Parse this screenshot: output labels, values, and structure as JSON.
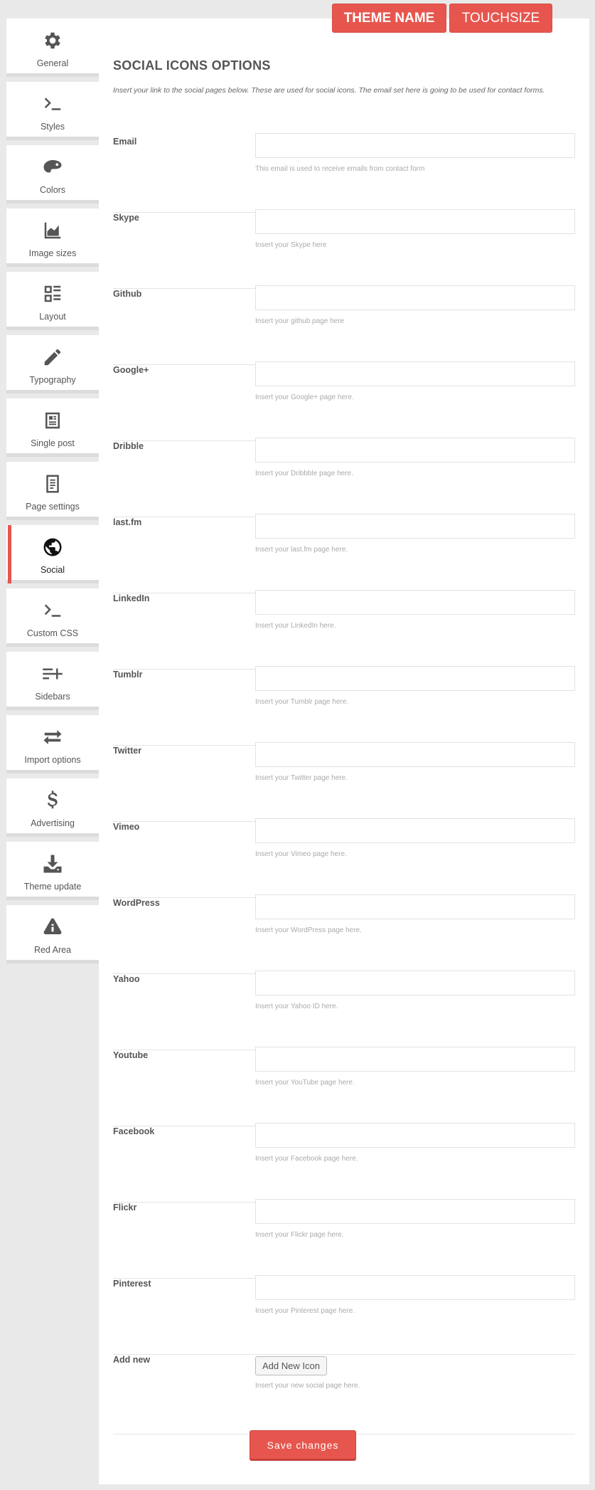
{
  "header": {
    "theme_label": "THEME NAME",
    "touchsize_label": "TOUCHSIZE"
  },
  "sidebar": {
    "items": [
      {
        "label": "General",
        "icon": "gear-icon"
      },
      {
        "label": "Styles",
        "icon": "terminal-icon"
      },
      {
        "label": "Colors",
        "icon": "palette-icon"
      },
      {
        "label": "Image sizes",
        "icon": "area-chart-icon"
      },
      {
        "label": "Layout",
        "icon": "layout-icon"
      },
      {
        "label": "Typography",
        "icon": "pencil-icon"
      },
      {
        "label": "Single post",
        "icon": "post-icon"
      },
      {
        "label": "Page settings",
        "icon": "page-icon"
      },
      {
        "label": "Social",
        "icon": "globe-icon",
        "active": true
      },
      {
        "label": "Custom CSS",
        "icon": "terminal-icon"
      },
      {
        "label": "Sidebars",
        "icon": "list-add-icon"
      },
      {
        "label": "Import options",
        "icon": "swap-arrows-icon"
      },
      {
        "label": "Advertising",
        "icon": "dollar-icon"
      },
      {
        "label": "Theme update",
        "icon": "download-icon"
      },
      {
        "label": "Red Area",
        "icon": "warning-icon"
      }
    ]
  },
  "main": {
    "title": "SOCIAL ICONS OPTIONS",
    "description": "Insert your link to the social pages below. These are used for social icons. The email set here is going to be used for contact forms.",
    "fields": [
      {
        "label": "Email",
        "value": "",
        "help": "This email is used to receive emails from contact form"
      },
      {
        "label": "Skype",
        "value": "",
        "help": "Insert your Skype here"
      },
      {
        "label": "Github",
        "value": "",
        "help": "Insert your github page here"
      },
      {
        "label": "Google+",
        "value": "",
        "help": "Insert your Google+ page here."
      },
      {
        "label": "Dribble",
        "value": "",
        "help": "Insert your Dribbble page here."
      },
      {
        "label": "last.fm",
        "value": "",
        "help": "Insert your last.fm page here."
      },
      {
        "label": "LinkedIn",
        "value": "",
        "help": "Insert your LinkedIn here."
      },
      {
        "label": "Tumblr",
        "value": "",
        "help": "Insert your Tumblr page here."
      },
      {
        "label": "Twitter",
        "value": "",
        "help": "Insert your Twitter page here."
      },
      {
        "label": "Vimeo",
        "value": "",
        "help": "Insert your Vimeo page here."
      },
      {
        "label": "WordPress",
        "value": "",
        "help": "Insert your WordPress page here."
      },
      {
        "label": "Yahoo",
        "value": "",
        "help": "Insert your Yahoo ID here."
      },
      {
        "label": "Youtube",
        "value": "",
        "help": "Insert your YouTube page here."
      },
      {
        "label": "Facebook",
        "value": "",
        "help": "Insert your Facebook page here."
      },
      {
        "label": "Flickr",
        "value": "",
        "help": "Insert your Flickr page here."
      },
      {
        "label": "Pinterest",
        "value": "",
        "help": "Insert your Pinterest page here."
      }
    ],
    "add_new": {
      "label": "Add new",
      "button": "Add New Icon",
      "help": "Insert your new social page here."
    },
    "save_label": "Save changes"
  },
  "colors": {
    "accent": "#e7564e",
    "background": "#e9e9e9"
  }
}
